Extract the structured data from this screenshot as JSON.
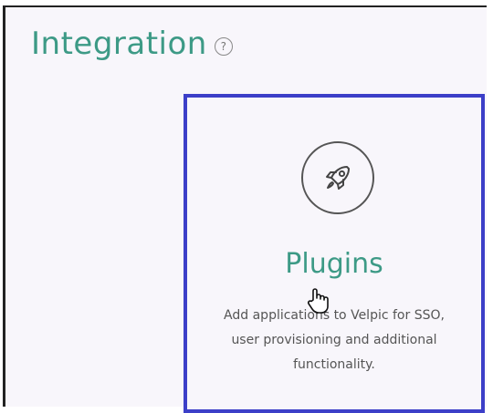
{
  "header": {
    "title": "Integration",
    "help_icon": "question-mark-circle-icon",
    "help_glyph": "?"
  },
  "plugins_card": {
    "icon": "rocket-icon",
    "title": "Plugins",
    "description": "Add applications to Velpic for SSO, user provisioning and additional functionality.",
    "accent_color": "#3d9a86",
    "border_color": "#3c3fc8"
  },
  "cursor": {
    "icon": "hand-pointer-icon"
  }
}
